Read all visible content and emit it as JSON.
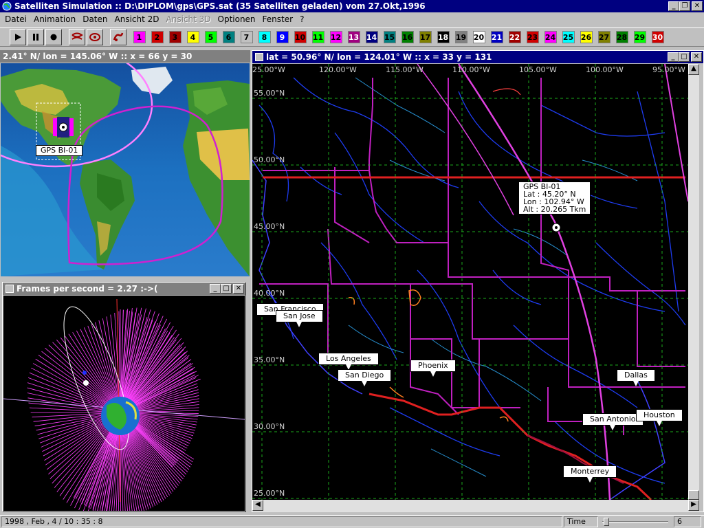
{
  "window": {
    "title": "Satelliten Simulation :: D:\\DIPLOM\\gps\\GPS.sat (35 Satelliten geladen) vom 27.Okt,1996"
  },
  "menu": [
    {
      "label": "Datei",
      "disabled": false
    },
    {
      "label": "Animation",
      "disabled": false
    },
    {
      "label": "Daten",
      "disabled": false
    },
    {
      "label": "Ansicht 2D",
      "disabled": false
    },
    {
      "label": "Ansicht 3D",
      "disabled": true
    },
    {
      "label": "Optionen",
      "disabled": false
    },
    {
      "label": "Fenster",
      "disabled": false
    },
    {
      "label": "?",
      "disabled": false
    }
  ],
  "toolbar": {
    "play_icon": "play-icon",
    "pause_icon": "pause-icon",
    "record_icon": "record-icon",
    "satellites": [
      {
        "n": "1",
        "bg": "#ff00ff",
        "fg": "#000"
      },
      {
        "n": "2",
        "bg": "#d00000",
        "fg": "#000"
      },
      {
        "n": "3",
        "bg": "#a00000",
        "fg": "#000"
      },
      {
        "n": "4",
        "bg": "#ffff00",
        "fg": "#000"
      },
      {
        "n": "5",
        "bg": "#00ff00",
        "fg": "#000"
      },
      {
        "n": "6",
        "bg": "#008080",
        "fg": "#000"
      },
      {
        "n": "7",
        "bg": "#c0c0c0",
        "fg": "#000"
      },
      {
        "n": "8",
        "bg": "#00ffff",
        "fg": "#000"
      },
      {
        "n": "9",
        "bg": "#0000ff",
        "fg": "#fff"
      },
      {
        "n": "10",
        "bg": "#d00000",
        "fg": "#000"
      },
      {
        "n": "11",
        "bg": "#00ff00",
        "fg": "#000"
      },
      {
        "n": "12",
        "bg": "#ff00ff",
        "fg": "#000"
      },
      {
        "n": "13",
        "bg": "#a00080",
        "fg": "#fff"
      },
      {
        "n": "14",
        "bg": "#000080",
        "fg": "#fff"
      },
      {
        "n": "15",
        "bg": "#008080",
        "fg": "#000"
      },
      {
        "n": "16",
        "bg": "#008000",
        "fg": "#000"
      },
      {
        "n": "17",
        "bg": "#808000",
        "fg": "#000"
      },
      {
        "n": "18",
        "bg": "#000000",
        "fg": "#fff"
      },
      {
        "n": "19",
        "bg": "#808080",
        "fg": "#000"
      },
      {
        "n": "20",
        "bg": "#ffffff",
        "fg": "#000"
      },
      {
        "n": "21",
        "bg": "#0000c0",
        "fg": "#fff"
      },
      {
        "n": "22",
        "bg": "#a00000",
        "fg": "#fff"
      },
      {
        "n": "23",
        "bg": "#d00000",
        "fg": "#000"
      },
      {
        "n": "24",
        "bg": "#ff00ff",
        "fg": "#000"
      },
      {
        "n": "25",
        "bg": "#00ffff",
        "fg": "#000"
      },
      {
        "n": "26",
        "bg": "#ffff00",
        "fg": "#000"
      },
      {
        "n": "27",
        "bg": "#808000",
        "fg": "#000"
      },
      {
        "n": "28",
        "bg": "#008000",
        "fg": "#000"
      },
      {
        "n": "29",
        "bg": "#00ff00",
        "fg": "#000"
      },
      {
        "n": "30",
        "bg": "#d00000",
        "fg": "#fff"
      }
    ]
  },
  "world_panel": {
    "title": "2.41° N/ lon = 145.06° W :: x = 66 y = 30",
    "sat_label": "GPS BI-01"
  },
  "fps_panel": {
    "title": "Frames per second = 2.27 :->("
  },
  "map_panel": {
    "title": "lat = 50.96° N/ lon = 124.01° W :: x = 33 y = 131",
    "lon_ticks": [
      "25.00°W",
      "120.00°W",
      "115.00°W",
      "110.00°W",
      "105.00°W",
      "100.00°W",
      "95.00°W"
    ],
    "lat_ticks": [
      "55.00°N",
      "50.00°N",
      "45.00°N",
      "40.00°N",
      "35.00°N",
      "30.00°N",
      "25.00°N"
    ],
    "sat_info": {
      "name": "GPS BI-01",
      "lat": "Lat : 45.20° N",
      "lon": "Lon : 102.94° W",
      "alt": "Alt : 20.265 Tkm"
    },
    "cities": [
      "San Francisco",
      "San Jose",
      "Los Angeles",
      "San Diego",
      "Phoenix",
      "Dallas",
      "San Antonio",
      "Houston",
      "Monterrey"
    ]
  },
  "status": {
    "datetime": "1998 , Feb , 4 / 10 : 35 : 8",
    "time_label": "Time",
    "time_value": "6"
  }
}
